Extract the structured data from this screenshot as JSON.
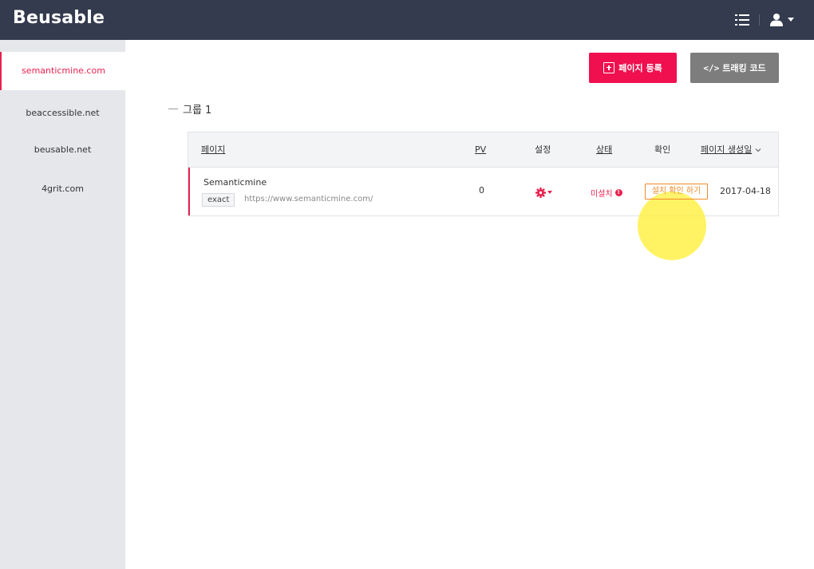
{
  "app": {
    "logo": "Beusable"
  },
  "sidebar": {
    "items": [
      {
        "label": "semanticmine.com",
        "active": true
      },
      {
        "label": "beaccessible.net",
        "active": false
      },
      {
        "label": "beusable.net",
        "active": false
      },
      {
        "label": "4grit.com",
        "active": false
      }
    ]
  },
  "toolbar": {
    "register_label": "페이지 등록",
    "tracking_icon": "</>",
    "tracking_label": "트래킹 코드"
  },
  "group": {
    "title": "그룹 1"
  },
  "table": {
    "headers": {
      "page": "페이지",
      "pv": "PV",
      "settings": "설정",
      "status": "상태",
      "verify": "확인",
      "created": "페이지 생성일"
    },
    "rows": [
      {
        "name": "Semanticmine",
        "match": "exact",
        "url": "https://www.semanticmine.com/",
        "pv": "0",
        "status": "미설치",
        "verify_label": "설치 확인 하기",
        "created": "2017-04-18"
      }
    ]
  },
  "colors": {
    "topbar": "#343b4e",
    "accent": "#e8214f",
    "register_button": "#f0104f",
    "tracking_button": "#7d7d7d",
    "verify_button": "#f08a2a",
    "highlight": "#fff038"
  },
  "icons": {
    "topbar": [
      "list-icon",
      "user-icon",
      "caret-down-icon"
    ],
    "register": "plus-box-icon",
    "settings": "gear-icon",
    "status": "info-icon",
    "sort": "chevron-down-icon"
  }
}
